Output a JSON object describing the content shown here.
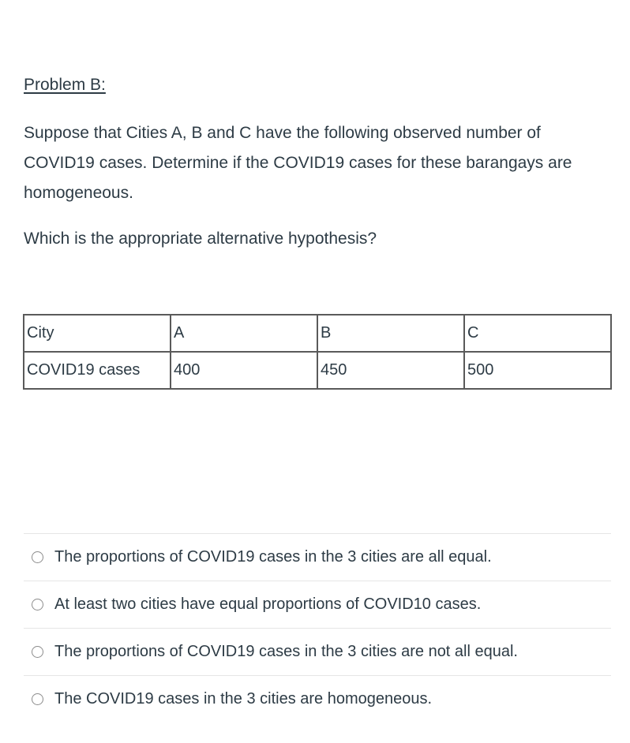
{
  "problem": {
    "title": "Problem B:",
    "description": "Suppose that Cities A, B and C have the following observed number of COVID19 cases. Determine if the COVID19 cases for these barangays are homogeneous.",
    "question": "Which is the appropriate alternative hypothesis?"
  },
  "table": {
    "rows": [
      [
        "City",
        "A",
        "B",
        "C"
      ],
      [
        "COVID19 cases",
        "400",
        "450",
        "500"
      ]
    ]
  },
  "answers": [
    {
      "label": "The proportions of COVID19 cases in the 3 cities are all equal.",
      "selected": false
    },
    {
      "label": "At least two cities have equal proportions of COVID10 cases.",
      "selected": false
    },
    {
      "label": "The proportions of COVID19 cases in the 3 cities are not all equal.",
      "selected": false
    },
    {
      "label": "The COVID19 cases in the 3 cities are homogeneous.",
      "selected": false
    }
  ]
}
